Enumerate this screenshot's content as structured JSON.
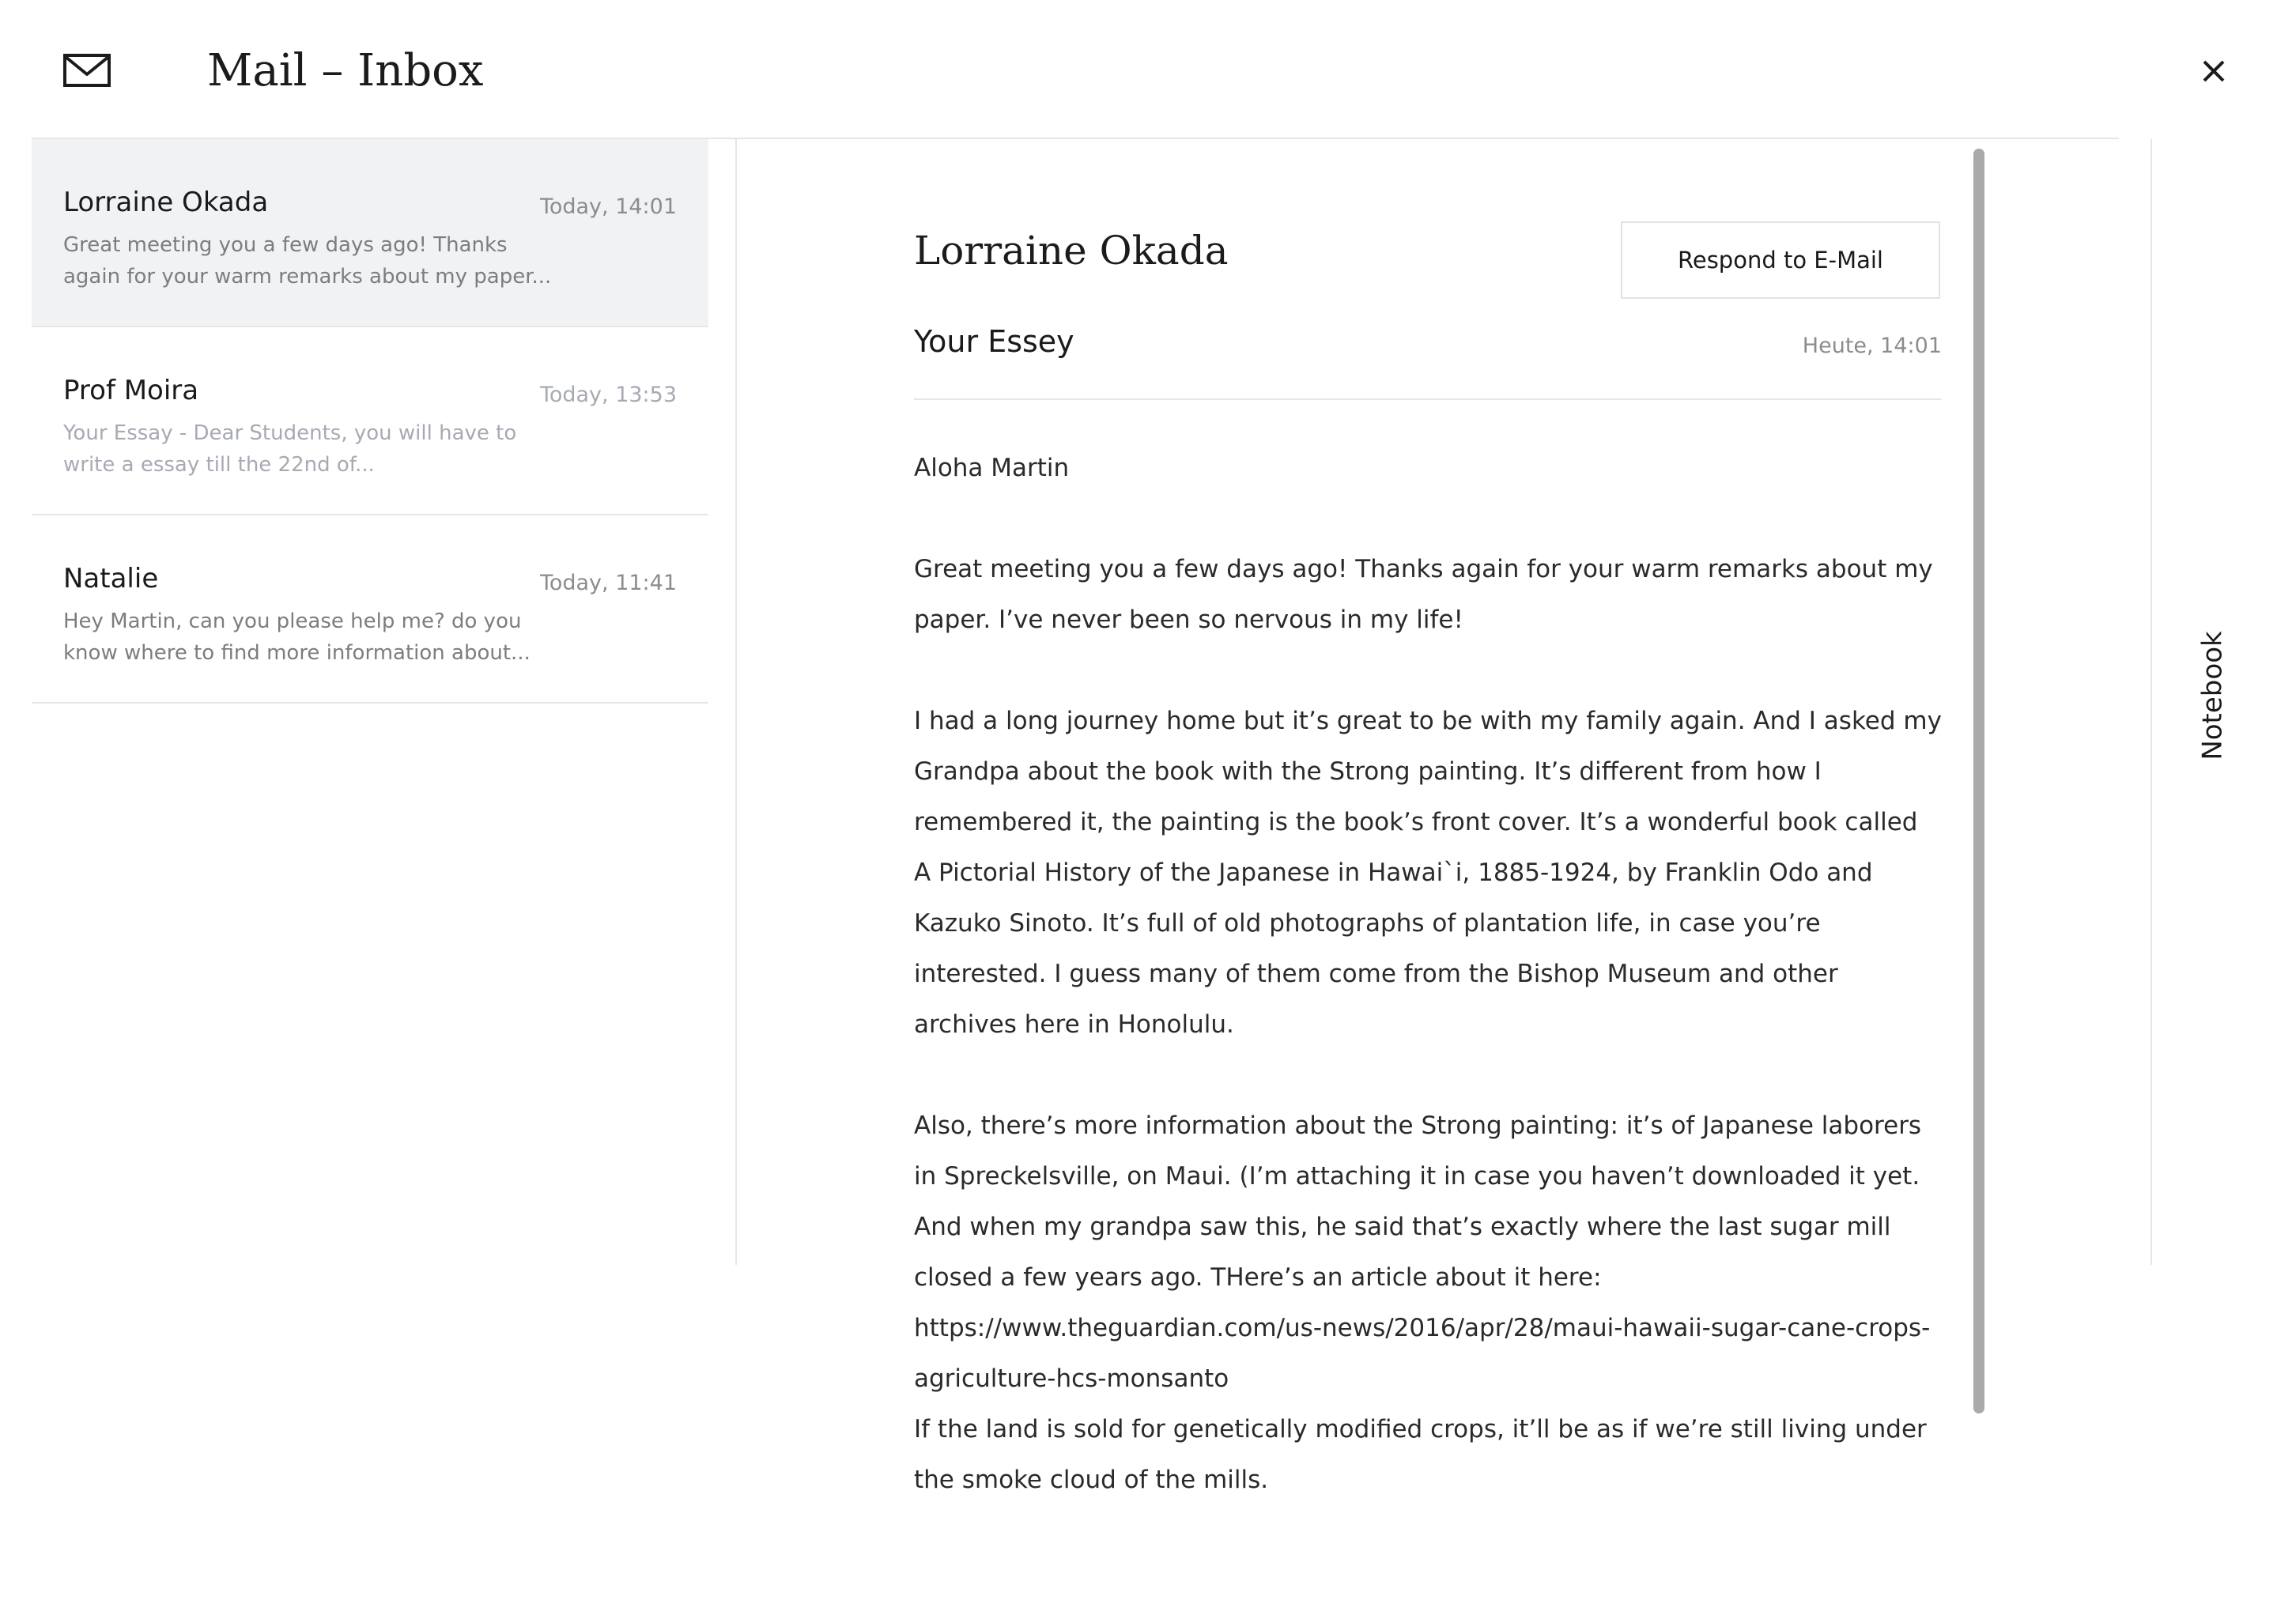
{
  "app": {
    "title": "Mail – Inbox",
    "icon": "envelope-icon",
    "close_icon": "close-icon"
  },
  "mails": [
    {
      "sender": "Lorraine Okada",
      "time": "Today, 14:01",
      "preview": "Great meeting you a few days ago! Thanks again for your warm remarks about my paper...",
      "selected": true
    },
    {
      "sender": "Prof Moira",
      "time": "Today, 13:53",
      "preview": "Your Essay - Dear Students, you will have to write a essay till the 22nd of...",
      "selected": false
    },
    {
      "sender": "Natalie",
      "time": "Today, 11:41",
      "preview": "Hey Martin, can you please help me? do you know where to find more information about...",
      "selected": false
    }
  ],
  "reader": {
    "sender": "Lorraine Okada",
    "respond_label": "Respond to E-Mail",
    "subject": "Your Essey",
    "time": "Heute, 14:01",
    "body": [
      "Aloha Martin",
      "Great meeting you a few days ago! Thanks again for your warm remarks about my paper. I’ve never been so nervous in my life!",
      "I had a long journey home but it’s great to be with my family again. And I asked my Grandpa about the book with the Strong painting. It’s different from how I remembered it, the painting is the book’s front cover. It’s a wonderful book called A Pictorial History of the Japanese in Hawai`i, 1885-1924, by Franklin Odo and Kazuko Sinoto. It’s full of old photographs of plantation life, in case you’re interested. I guess many of them come from the Bishop Museum and other archives here in Honolulu.",
      "Also, there’s more information about the Strong painting: it’s of Japanese laborers in Spreckelsville, on Maui. (I’m attaching it in case you haven’t downloaded it yet. And when my grandpa saw this, he said that’s exactly where the last sugar mill closed a few years ago. THere’s an article about it here:  https://www.theguardian.com/us-news/2016/apr/28/maui-hawaii-sugar-cane-crops-agriculture-hcs-monsanto",
      "If the land is sold for genetically modified crops, it’ll be as if we’re still living under the smoke cloud of the mills."
    ]
  },
  "side_tab": {
    "label": "Notebook"
  },
  "colors": {
    "selected_row_bg": "#f1f2f4",
    "divider": "#e6e6e6",
    "muted_text": "#8c8c8c",
    "scrollbar": "#aaaaaa"
  }
}
